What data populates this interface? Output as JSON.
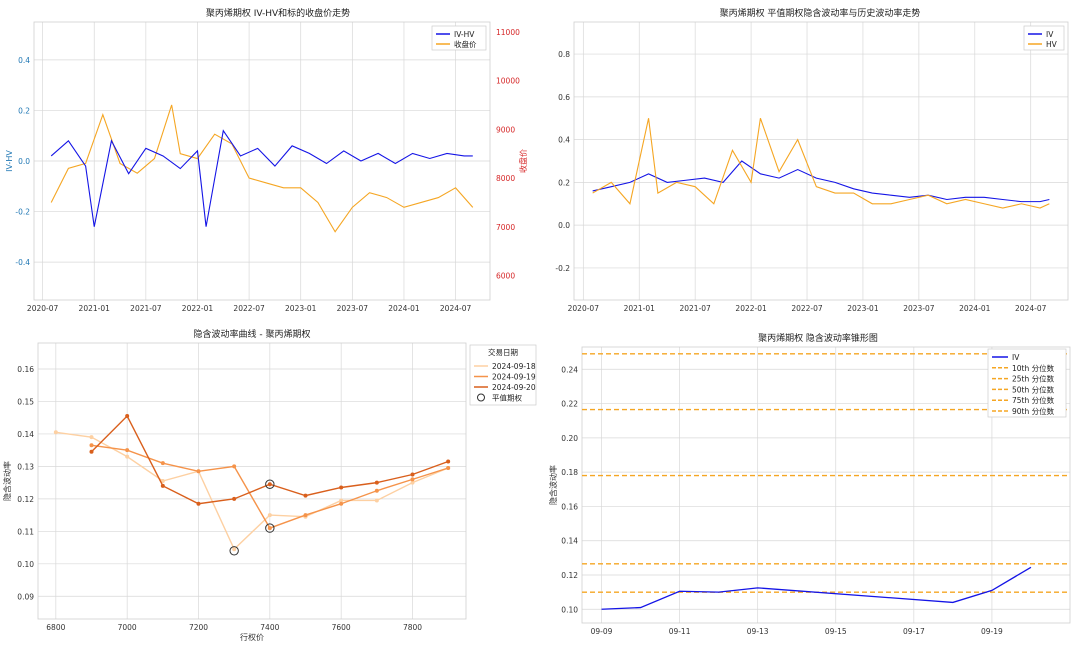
{
  "charts": {
    "c1": {
      "title": "聚丙烯期权 IV-HV和标的收盘价走势"
    },
    "c2": {
      "title": "聚丙烯期权 平值期权隐含波动率与历史波动率走势"
    },
    "c3": {
      "title": "隐含波动率曲线 - 聚丙烯期权"
    },
    "c4": {
      "title": "聚丙烯期权 隐含波动率锥形图"
    }
  },
  "colors": {
    "blue": "#1414e6",
    "orange": "#f5a623",
    "grid": "#d8d8d8",
    "s18": "#fdd0a2",
    "s19": "#f5934a",
    "s20": "#d95f1c",
    "dashed": "#f5a623"
  },
  "chart_data": [
    {
      "type": "line",
      "title": "聚丙烯期权 IV-HV和标的收盘价走势",
      "ylabel": "IV-HV",
      "y2label": "收盘价",
      "x_ticks": [
        "2020-07",
        "2021-01",
        "2021-07",
        "2022-01",
        "2022-07",
        "2023-01",
        "2023-07",
        "2024-01",
        "2024-07"
      ],
      "y_ticks": [
        "-0.4",
        "-0.2",
        "0.0",
        "0.2",
        "0.4"
      ],
      "y2_ticks": [
        "6000",
        "7000",
        "8000",
        "9000",
        "10000",
        "11000"
      ],
      "ylim": [
        -0.55,
        0.55
      ],
      "y2lim": [
        5500,
        11200
      ],
      "legend": [
        "IV-HV",
        "收盘价"
      ],
      "legend_position": "upper right",
      "series": [
        {
          "name": "IV-HV",
          "axis": "left",
          "x": [
            "2020-08",
            "2020-10",
            "2020-12",
            "2021-01",
            "2021-03",
            "2021-05",
            "2021-07",
            "2021-09",
            "2021-11",
            "2022-01",
            "2022-02",
            "2022-04",
            "2022-06",
            "2022-08",
            "2022-10",
            "2022-12",
            "2023-02",
            "2023-04",
            "2023-06",
            "2023-08",
            "2023-10",
            "2023-12",
            "2024-02",
            "2024-04",
            "2024-06",
            "2024-08",
            "2024-09"
          ],
          "values": [
            0.02,
            0.08,
            -0.02,
            -0.26,
            0.08,
            -0.05,
            0.05,
            0.02,
            -0.03,
            0.04,
            -0.26,
            0.12,
            0.02,
            0.05,
            -0.02,
            0.06,
            0.03,
            -0.01,
            0.04,
            0.0,
            0.03,
            -0.01,
            0.03,
            0.01,
            0.03,
            0.02,
            0.02
          ]
        },
        {
          "name": "收盘价",
          "axis": "right",
          "x": [
            "2020-08",
            "2020-10",
            "2020-12",
            "2021-02",
            "2021-04",
            "2021-06",
            "2021-08",
            "2021-10",
            "2021-11",
            "2022-01",
            "2022-03",
            "2022-05",
            "2022-07",
            "2022-09",
            "2022-11",
            "2023-01",
            "2023-03",
            "2023-05",
            "2023-07",
            "2023-09",
            "2023-11",
            "2024-01",
            "2024-03",
            "2024-05",
            "2024-07",
            "2024-09"
          ],
          "values": [
            7500,
            8200,
            8300,
            9300,
            8300,
            8100,
            8400,
            9500,
            8500,
            8400,
            8900,
            8700,
            8000,
            7900,
            7800,
            7800,
            7500,
            6900,
            7400,
            7700,
            7600,
            7400,
            7500,
            7600,
            7800,
            7400
          ]
        }
      ]
    },
    {
      "type": "line",
      "title": "聚丙烯期权 平值期权隐含波动率与历史波动率走势",
      "x_ticks": [
        "2020-07",
        "2021-01",
        "2021-07",
        "2022-01",
        "2022-07",
        "2023-01",
        "2023-07",
        "2024-01",
        "2024-07"
      ],
      "y_ticks": [
        "-0.2",
        "0.0",
        "0.2",
        "0.4",
        "0.6",
        "0.8"
      ],
      "ylim": [
        -0.35,
        0.95
      ],
      "legend": [
        "IV",
        "HV"
      ],
      "legend_position": "upper right",
      "series": [
        {
          "name": "IV",
          "x": [
            "2020-08",
            "2020-10",
            "2020-12",
            "2021-02",
            "2021-04",
            "2021-06",
            "2021-08",
            "2021-10",
            "2021-12",
            "2022-02",
            "2022-04",
            "2022-06",
            "2022-08",
            "2022-10",
            "2022-12",
            "2023-02",
            "2023-04",
            "2023-06",
            "2023-08",
            "2023-10",
            "2023-12",
            "2024-02",
            "2024-04",
            "2024-06",
            "2024-08",
            "2024-09"
          ],
          "values": [
            0.16,
            0.18,
            0.2,
            0.24,
            0.2,
            0.21,
            0.22,
            0.2,
            0.3,
            0.24,
            0.22,
            0.26,
            0.22,
            0.2,
            0.17,
            0.15,
            0.14,
            0.13,
            0.14,
            0.12,
            0.13,
            0.13,
            0.12,
            0.11,
            0.11,
            0.12
          ]
        },
        {
          "name": "HV",
          "x": [
            "2020-08",
            "2020-10",
            "2020-12",
            "2021-02",
            "2021-03",
            "2021-05",
            "2021-07",
            "2021-09",
            "2021-11",
            "2022-01",
            "2022-02",
            "2022-04",
            "2022-06",
            "2022-08",
            "2022-10",
            "2022-12",
            "2023-02",
            "2023-04",
            "2023-06",
            "2023-08",
            "2023-10",
            "2023-12",
            "2024-02",
            "2024-04",
            "2024-06",
            "2024-08",
            "2024-09"
          ],
          "values": [
            0.15,
            0.2,
            0.1,
            0.5,
            0.15,
            0.2,
            0.18,
            0.1,
            0.35,
            0.2,
            0.5,
            0.25,
            0.4,
            0.18,
            0.15,
            0.15,
            0.1,
            0.1,
            0.12,
            0.14,
            0.1,
            0.12,
            0.1,
            0.08,
            0.1,
            0.08,
            0.1
          ]
        }
      ]
    },
    {
      "type": "line",
      "title": "隐含波动率曲线 - 聚丙烯期权",
      "xlabel": "行权价",
      "ylabel": "隐含波动率",
      "x_ticks": [
        "6800",
        "7000",
        "7200",
        "7400",
        "7600",
        "7800"
      ],
      "y_ticks": [
        "0.09",
        "0.10",
        "0.11",
        "0.12",
        "0.13",
        "0.14",
        "0.15",
        "0.16"
      ],
      "xlim": [
        6750,
        7950
      ],
      "ylim": [
        0.083,
        0.168
      ],
      "legend_title": "交易日期",
      "legend": [
        "2024-09-18",
        "2024-09-19",
        "2024-09-20",
        "平值期权"
      ],
      "legend_position": "upper right",
      "series": [
        {
          "name": "2024-09-18",
          "x": [
            6800,
            6900,
            7000,
            7100,
            7200,
            7300,
            7400,
            7500,
            7600,
            7700,
            7800,
            7900
          ],
          "values": [
            0.1405,
            0.139,
            0.133,
            0.1255,
            0.1285,
            0.1045,
            0.115,
            0.1145,
            0.1195,
            0.1195,
            0.125,
            0.1295
          ]
        },
        {
          "name": "2024-09-19",
          "x": [
            6900,
            7000,
            7100,
            7200,
            7300,
            7400,
            7500,
            7600,
            7700,
            7800,
            7900
          ],
          "values": [
            0.1365,
            0.135,
            0.131,
            0.1285,
            0.13,
            0.111,
            0.115,
            0.1185,
            0.1225,
            0.126,
            0.1295
          ]
        },
        {
          "name": "2024-09-20",
          "x": [
            6900,
            7000,
            7100,
            7200,
            7300,
            7400,
            7500,
            7600,
            7700,
            7800,
            7900
          ],
          "values": [
            0.1345,
            0.1455,
            0.124,
            0.1185,
            0.12,
            0.1245,
            0.121,
            0.1235,
            0.125,
            0.1275,
            0.1315
          ]
        }
      ],
      "atm_markers": [
        {
          "x": 7300,
          "value": 0.104
        },
        {
          "x": 7400,
          "value": 0.111
        },
        {
          "x": 7400,
          "value": 0.1245
        }
      ]
    },
    {
      "type": "line",
      "title": "聚丙烯期权 隐含波动率锥形图",
      "ylabel": "隐含波动率",
      "x_ticks": [
        "09-09",
        "09-11",
        "09-13",
        "09-15",
        "09-17",
        "09-19"
      ],
      "y_ticks": [
        "0.10",
        "0.12",
        "0.14",
        "0.16",
        "0.18",
        "0.20",
        "0.22",
        "0.24"
      ],
      "ylim": [
        0.092,
        0.253
      ],
      "legend": [
        "IV",
        "10th 分位数",
        "25th 分位数",
        "50th 分位数",
        "75th 分位数",
        "90th 分位数"
      ],
      "legend_position": "upper right",
      "series": [
        {
          "name": "IV",
          "x": [
            "09-09",
            "09-10",
            "09-11",
            "09-12",
            "09-13",
            "09-18",
            "09-19",
            "09-20"
          ],
          "values": [
            0.1,
            0.101,
            0.1105,
            0.11,
            0.1125,
            0.104,
            0.111,
            0.1245
          ]
        }
      ],
      "quantiles": [
        {
          "name": "10th 分位数",
          "value": 0.11
        },
        {
          "name": "25th 分位数",
          "value": 0.1265
        },
        {
          "name": "50th 分位数",
          "value": 0.178
        },
        {
          "name": "75th 分位数",
          "value": 0.2165
        },
        {
          "name": "90th 分位数",
          "value": 0.249
        }
      ]
    }
  ]
}
